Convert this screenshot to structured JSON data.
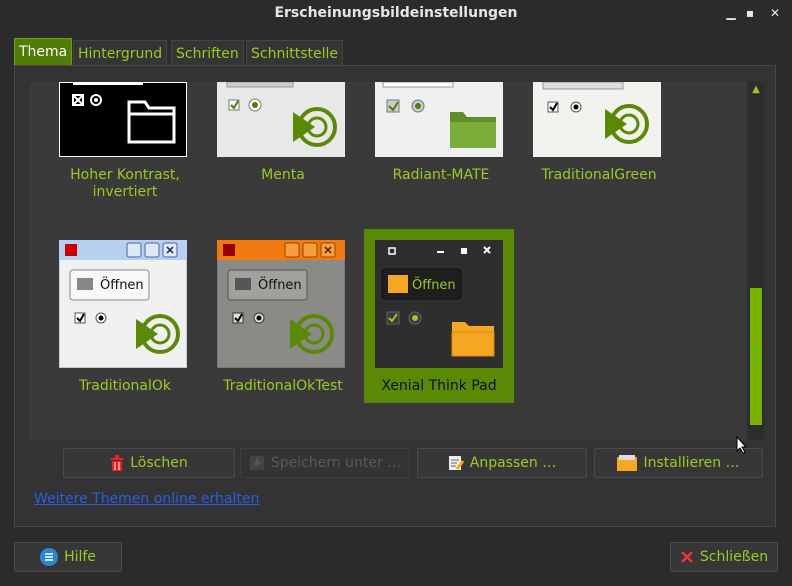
{
  "window": {
    "title": "Erscheinungsbildeinstellungen"
  },
  "tabs": [
    {
      "label": "Thema",
      "active": true
    },
    {
      "label": "Hintergrund",
      "active": false
    },
    {
      "label": "Schriften",
      "active": false
    },
    {
      "label": "Schnittstelle",
      "active": false
    }
  ],
  "themes": {
    "row1": [
      "Hoher Kontrast,",
      "invertiert",
      "Menta",
      "Radiant-MATE",
      "TraditionalGreen"
    ],
    "row2": [
      "TraditionalOk",
      "TraditionalOkTest",
      "Xenial Think Pad"
    ],
    "preview_open_label": "Öffnen",
    "selected": "Xenial Think Pad"
  },
  "actions": {
    "delete": "Löschen",
    "save_as": "Speichern unter …",
    "customize": "Anpassen …",
    "install": "Installieren …"
  },
  "more_themes_link": "Weitere Themen online erhalten",
  "footer": {
    "help": "Hilfe",
    "close": "Schließen"
  },
  "colors": {
    "accent": "#9bcb20",
    "selection": "#5a8a05",
    "link": "#2c5de8"
  }
}
